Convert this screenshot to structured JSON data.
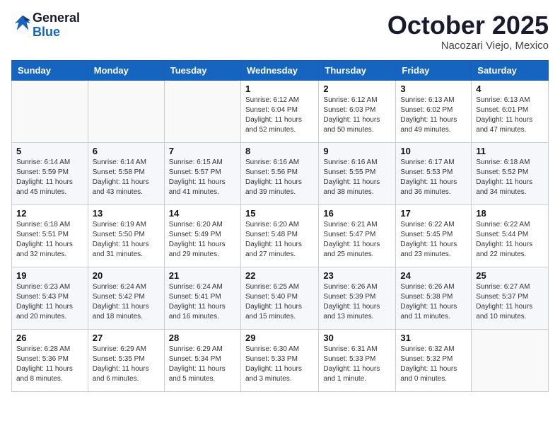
{
  "header": {
    "logo_line1": "General",
    "logo_line2": "Blue",
    "month": "October 2025",
    "location": "Nacozari Viejo, Mexico"
  },
  "weekdays": [
    "Sunday",
    "Monday",
    "Tuesday",
    "Wednesday",
    "Thursday",
    "Friday",
    "Saturday"
  ],
  "weeks": [
    [
      {
        "day": "",
        "text": ""
      },
      {
        "day": "",
        "text": ""
      },
      {
        "day": "",
        "text": ""
      },
      {
        "day": "1",
        "text": "Sunrise: 6:12 AM\nSunset: 6:04 PM\nDaylight: 11 hours\nand 52 minutes."
      },
      {
        "day": "2",
        "text": "Sunrise: 6:12 AM\nSunset: 6:03 PM\nDaylight: 11 hours\nand 50 minutes."
      },
      {
        "day": "3",
        "text": "Sunrise: 6:13 AM\nSunset: 6:02 PM\nDaylight: 11 hours\nand 49 minutes."
      },
      {
        "day": "4",
        "text": "Sunrise: 6:13 AM\nSunset: 6:01 PM\nDaylight: 11 hours\nand 47 minutes."
      }
    ],
    [
      {
        "day": "5",
        "text": "Sunrise: 6:14 AM\nSunset: 5:59 PM\nDaylight: 11 hours\nand 45 minutes."
      },
      {
        "day": "6",
        "text": "Sunrise: 6:14 AM\nSunset: 5:58 PM\nDaylight: 11 hours\nand 43 minutes."
      },
      {
        "day": "7",
        "text": "Sunrise: 6:15 AM\nSunset: 5:57 PM\nDaylight: 11 hours\nand 41 minutes."
      },
      {
        "day": "8",
        "text": "Sunrise: 6:16 AM\nSunset: 5:56 PM\nDaylight: 11 hours\nand 39 minutes."
      },
      {
        "day": "9",
        "text": "Sunrise: 6:16 AM\nSunset: 5:55 PM\nDaylight: 11 hours\nand 38 minutes."
      },
      {
        "day": "10",
        "text": "Sunrise: 6:17 AM\nSunset: 5:53 PM\nDaylight: 11 hours\nand 36 minutes."
      },
      {
        "day": "11",
        "text": "Sunrise: 6:18 AM\nSunset: 5:52 PM\nDaylight: 11 hours\nand 34 minutes."
      }
    ],
    [
      {
        "day": "12",
        "text": "Sunrise: 6:18 AM\nSunset: 5:51 PM\nDaylight: 11 hours\nand 32 minutes."
      },
      {
        "day": "13",
        "text": "Sunrise: 6:19 AM\nSunset: 5:50 PM\nDaylight: 11 hours\nand 31 minutes."
      },
      {
        "day": "14",
        "text": "Sunrise: 6:20 AM\nSunset: 5:49 PM\nDaylight: 11 hours\nand 29 minutes."
      },
      {
        "day": "15",
        "text": "Sunrise: 6:20 AM\nSunset: 5:48 PM\nDaylight: 11 hours\nand 27 minutes."
      },
      {
        "day": "16",
        "text": "Sunrise: 6:21 AM\nSunset: 5:47 PM\nDaylight: 11 hours\nand 25 minutes."
      },
      {
        "day": "17",
        "text": "Sunrise: 6:22 AM\nSunset: 5:45 PM\nDaylight: 11 hours\nand 23 minutes."
      },
      {
        "day": "18",
        "text": "Sunrise: 6:22 AM\nSunset: 5:44 PM\nDaylight: 11 hours\nand 22 minutes."
      }
    ],
    [
      {
        "day": "19",
        "text": "Sunrise: 6:23 AM\nSunset: 5:43 PM\nDaylight: 11 hours\nand 20 minutes."
      },
      {
        "day": "20",
        "text": "Sunrise: 6:24 AM\nSunset: 5:42 PM\nDaylight: 11 hours\nand 18 minutes."
      },
      {
        "day": "21",
        "text": "Sunrise: 6:24 AM\nSunset: 5:41 PM\nDaylight: 11 hours\nand 16 minutes."
      },
      {
        "day": "22",
        "text": "Sunrise: 6:25 AM\nSunset: 5:40 PM\nDaylight: 11 hours\nand 15 minutes."
      },
      {
        "day": "23",
        "text": "Sunrise: 6:26 AM\nSunset: 5:39 PM\nDaylight: 11 hours\nand 13 minutes."
      },
      {
        "day": "24",
        "text": "Sunrise: 6:26 AM\nSunset: 5:38 PM\nDaylight: 11 hours\nand 11 minutes."
      },
      {
        "day": "25",
        "text": "Sunrise: 6:27 AM\nSunset: 5:37 PM\nDaylight: 11 hours\nand 10 minutes."
      }
    ],
    [
      {
        "day": "26",
        "text": "Sunrise: 6:28 AM\nSunset: 5:36 PM\nDaylight: 11 hours\nand 8 minutes."
      },
      {
        "day": "27",
        "text": "Sunrise: 6:29 AM\nSunset: 5:35 PM\nDaylight: 11 hours\nand 6 minutes."
      },
      {
        "day": "28",
        "text": "Sunrise: 6:29 AM\nSunset: 5:34 PM\nDaylight: 11 hours\nand 5 minutes."
      },
      {
        "day": "29",
        "text": "Sunrise: 6:30 AM\nSunset: 5:33 PM\nDaylight: 11 hours\nand 3 minutes."
      },
      {
        "day": "30",
        "text": "Sunrise: 6:31 AM\nSunset: 5:33 PM\nDaylight: 11 hours\nand 1 minute."
      },
      {
        "day": "31",
        "text": "Sunrise: 6:32 AM\nSunset: 5:32 PM\nDaylight: 11 hours\nand 0 minutes."
      },
      {
        "day": "",
        "text": ""
      }
    ]
  ]
}
